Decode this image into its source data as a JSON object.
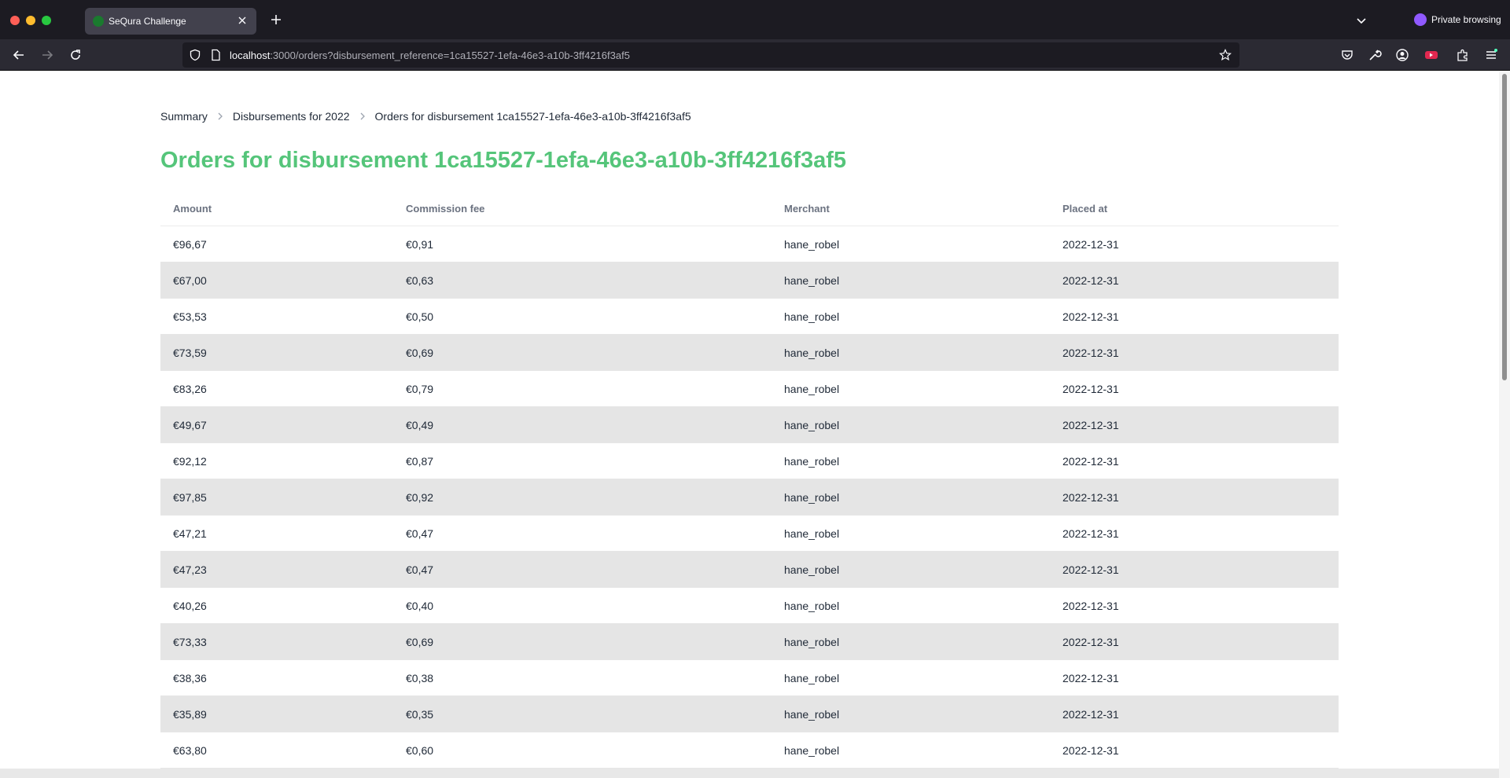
{
  "browser": {
    "tab_title": "SeQura Challenge",
    "private_label": "Private browsing",
    "url_host": "localhost",
    "url_rest": ":3000/orders?disbursement_reference=1ca15527-1efa-46e3-a10b-3ff4216f3af5"
  },
  "breadcrumb": {
    "items": [
      "Summary",
      "Disbursements for 2022",
      "Orders for disbursement 1ca15527-1efa-46e3-a10b-3ff4216f3af5"
    ]
  },
  "page": {
    "title": "Orders for disbursement 1ca15527-1efa-46e3-a10b-3ff4216f3af5"
  },
  "table": {
    "columns": [
      "Amount",
      "Commission fee",
      "Merchant",
      "Placed at"
    ],
    "rows": [
      [
        "€96,67",
        "€0,91",
        "hane_robel",
        "2022-12-31"
      ],
      [
        "€67,00",
        "€0,63",
        "hane_robel",
        "2022-12-31"
      ],
      [
        "€53,53",
        "€0,50",
        "hane_robel",
        "2022-12-31"
      ],
      [
        "€73,59",
        "€0,69",
        "hane_robel",
        "2022-12-31"
      ],
      [
        "€83,26",
        "€0,79",
        "hane_robel",
        "2022-12-31"
      ],
      [
        "€49,67",
        "€0,49",
        "hane_robel",
        "2022-12-31"
      ],
      [
        "€92,12",
        "€0,87",
        "hane_robel",
        "2022-12-31"
      ],
      [
        "€97,85",
        "€0,92",
        "hane_robel",
        "2022-12-31"
      ],
      [
        "€47,21",
        "€0,47",
        "hane_robel",
        "2022-12-31"
      ],
      [
        "€47,23",
        "€0,47",
        "hane_robel",
        "2022-12-31"
      ],
      [
        "€40,26",
        "€0,40",
        "hane_robel",
        "2022-12-31"
      ],
      [
        "€73,33",
        "€0,69",
        "hane_robel",
        "2022-12-31"
      ],
      [
        "€38,36",
        "€0,38",
        "hane_robel",
        "2022-12-31"
      ],
      [
        "€35,89",
        "€0,35",
        "hane_robel",
        "2022-12-31"
      ],
      [
        "€63,80",
        "€0,60",
        "hane_robel",
        "2022-12-31"
      ]
    ]
  },
  "icons": {
    "back": "arrow-left-icon",
    "forward": "arrow-right-icon",
    "reload": "reload-icon",
    "shield": "shield-icon",
    "page": "page-icon",
    "bookmark": "star-icon",
    "pocket": "pocket-icon",
    "tools": "wrench-icon",
    "account": "account-icon",
    "extensions": "puzzle-icon",
    "menu": "hamburger-icon"
  },
  "colors": {
    "title_green": "#55c57a",
    "row_alt": "#e5e5e5"
  }
}
